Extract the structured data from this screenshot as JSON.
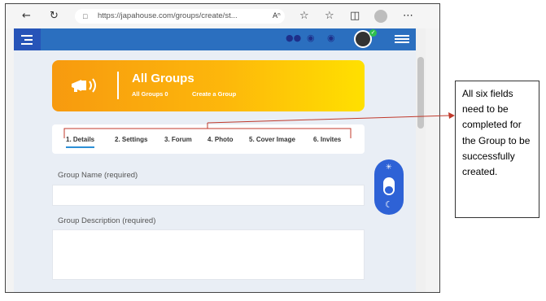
{
  "browser": {
    "url": "https://japahouse.com/groups/create/st...",
    "icons": [
      "back-icon",
      "refresh-icon",
      "lock-icon",
      "read-aloud-icon",
      "favorite-add-icon",
      "favorites-icon",
      "collections-icon",
      "profile-icon",
      "more-icon"
    ]
  },
  "header": {
    "icons": [
      "menu-icon",
      "members-icon",
      "messages-icon",
      "notifications-icon",
      "user-avatar",
      "verified-badge",
      "hamburger-icon"
    ]
  },
  "banner": {
    "title": "All Groups",
    "all_groups_link": "All Groups 0",
    "create_link": "Create a Group",
    "icon": "megaphone-icon",
    "colors": {
      "start": "#f79a0f",
      "end": "#ffe000"
    }
  },
  "tabs": [
    {
      "label": "1. Details",
      "active": true
    },
    {
      "label": "2. Settings",
      "active": false
    },
    {
      "label": "3. Forum",
      "active": false
    },
    {
      "label": "4. Photo",
      "active": false
    },
    {
      "label": "5. Cover Image",
      "active": false
    },
    {
      "label": "6. Invites",
      "active": false
    }
  ],
  "form": {
    "group_name_label": "Group Name (required)",
    "group_name_value": "",
    "group_description_label": "Group Description (required)",
    "group_description_value": ""
  },
  "theme_toggle": {
    "icons": [
      "sun-icon",
      "moon-icon"
    ]
  },
  "annotation": {
    "text": "All six fields need to be completed for the Group to be successfully created.",
    "color": "#c0392b"
  }
}
